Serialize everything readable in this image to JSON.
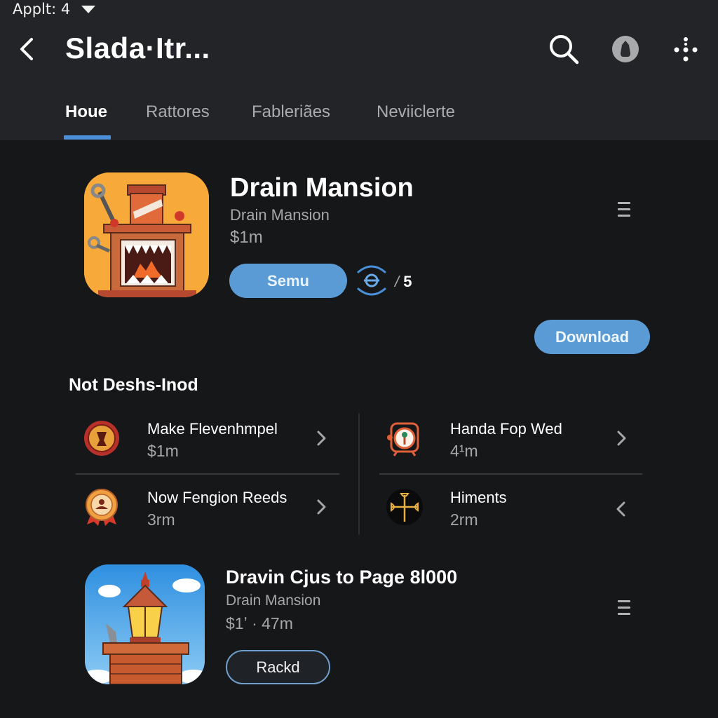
{
  "status_bar": {
    "text": "Applt: 4"
  },
  "header": {
    "title": "Slada·Itr...",
    "back_label": "Back",
    "actions": [
      "search-icon",
      "profile-icon",
      "more-icon"
    ]
  },
  "tabs": [
    {
      "label": "Houe",
      "active": true
    },
    {
      "label": "Rattores",
      "active": false
    },
    {
      "label": "Fableriães",
      "active": false
    },
    {
      "label": "Neviiclerte",
      "active": false
    }
  ],
  "featured": {
    "title": "Drain Mansion",
    "developer": "Drain Mansion",
    "price": "$1m",
    "primary_button": "Semu",
    "rating_value": "5",
    "rating_sep": "/",
    "download_button": "Download",
    "colors": {
      "accent": "#5b9bd5",
      "icon_bg": "#f7a93a"
    }
  },
  "section": {
    "title": "Not Deshs-Inod",
    "items": [
      {
        "title": "Make Flevenhmpel",
        "sub": "$1m",
        "icon": "medallion-icon",
        "chevron": "chevron-right-icon"
      },
      {
        "title": "Handa Fop Wed",
        "sub": "4¹m",
        "icon": "clock-badge-icon",
        "chevron": "chevron-right-icon"
      },
      {
        "title": "Now Fengion Reeds",
        "sub": "3rm",
        "icon": "award-ribbon-icon",
        "chevron": "chevron-right-icon"
      },
      {
        "title": "Himents",
        "sub": "2rm",
        "icon": "cross-emblem-icon",
        "chevron": "chevron-left-icon"
      }
    ]
  },
  "second_app": {
    "title": "Dravin Cjus to Page 8l000",
    "developer": "Drain Mansion",
    "price": "$1ʼ  ·  47m",
    "button": "Rackd"
  }
}
